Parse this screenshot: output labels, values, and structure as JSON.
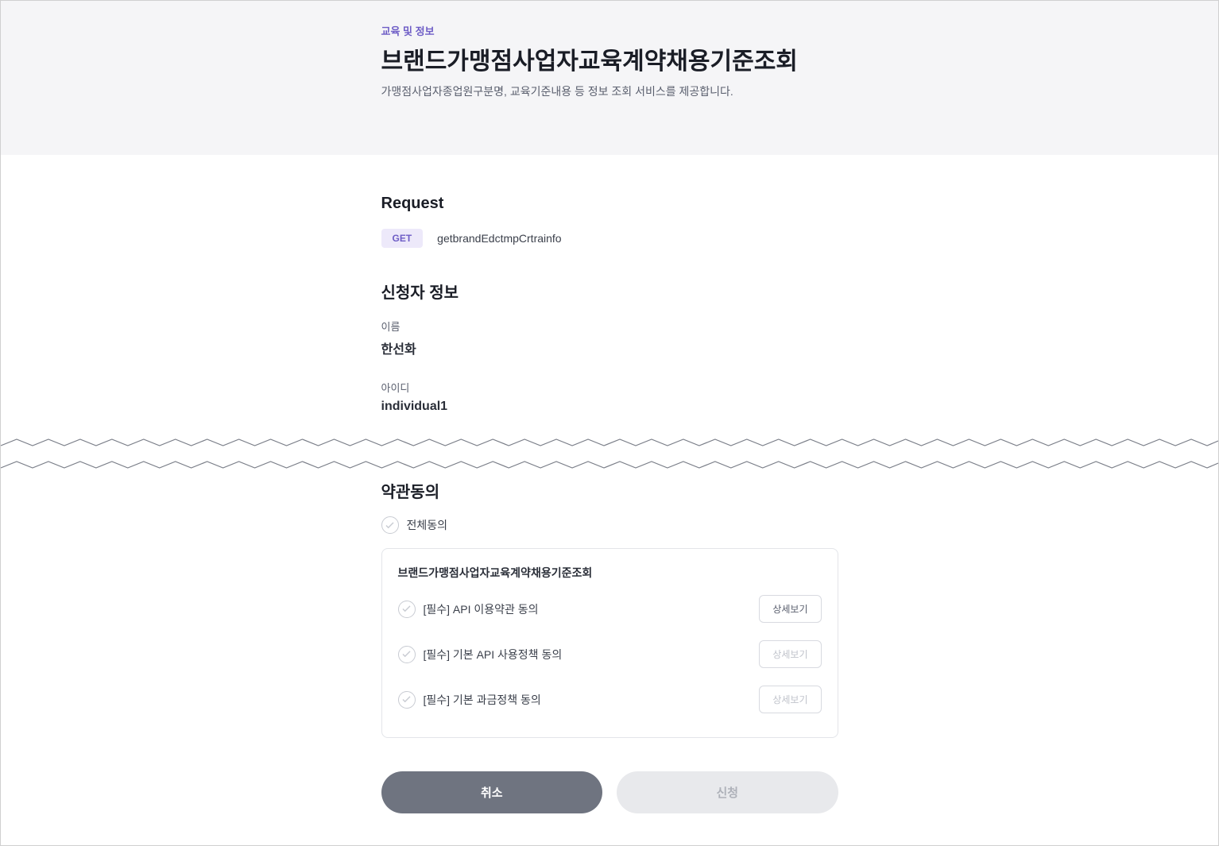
{
  "header": {
    "category": "교육 및 정보",
    "title": "브랜드가맹점사업자교육계약채용기준조회",
    "desc": "가맹점사업자종업원구분명, 교육기준내용 등 정보 조회 서비스를 제공합니다."
  },
  "request": {
    "heading": "Request",
    "method": "GET",
    "endpoint": "getbrandEdctmpCrtrainfo"
  },
  "applicant": {
    "heading": "신청자 정보",
    "nameLabel": "이름",
    "nameValue": "한선화",
    "idLabel": "아이디",
    "idValue": "individual1"
  },
  "terms": {
    "heading": "약관동의",
    "agreeAll": "전체동의",
    "boxTitle": "브랜드가맹점사업자교육계약채용기준조회",
    "items": [
      {
        "label": "[필수] API 이용약관 동의",
        "detail": "상세보기",
        "detailEnabled": true
      },
      {
        "label": "[필수] 기본 API 사용정책 동의",
        "detail": "상세보기",
        "detailEnabled": false
      },
      {
        "label": "[필수] 기본 과금정책 동의",
        "detail": "상세보기",
        "detailEnabled": false
      }
    ]
  },
  "actions": {
    "cancel": "취소",
    "submit": "신청"
  }
}
